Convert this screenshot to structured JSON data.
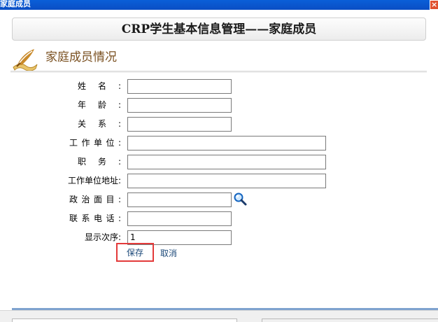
{
  "window": {
    "title": "家庭成员"
  },
  "header": {
    "title": "CRP学生基本信息管理——家庭成员"
  },
  "section": {
    "title": "家庭成员情况"
  },
  "form": {
    "name_label": "姓名:",
    "age_label": "年龄:",
    "relation_label": "关系:",
    "workplace_label": "工作单位:",
    "position_label": "职务:",
    "address_label": "工作单位地址:",
    "political_label": "政治面目:",
    "phone_label": "联系电话:",
    "order_label": "显示次序:",
    "name_value": "",
    "age_value": "",
    "relation_value": "",
    "workplace_value": "",
    "position_value": "",
    "address_value": "",
    "political_value": "",
    "phone_value": "",
    "order_value": "1"
  },
  "actions": {
    "save_label": "保存",
    "cancel_label": "取消"
  },
  "colors": {
    "title_bar": "#0a4ec4",
    "save_border": "#e33a3a",
    "section_text": "#7a5020",
    "link_text": "#1d4a7a"
  },
  "icons": {
    "section": "quill-paper-icon",
    "lookup": "magnifier-icon",
    "close": "close-icon"
  }
}
